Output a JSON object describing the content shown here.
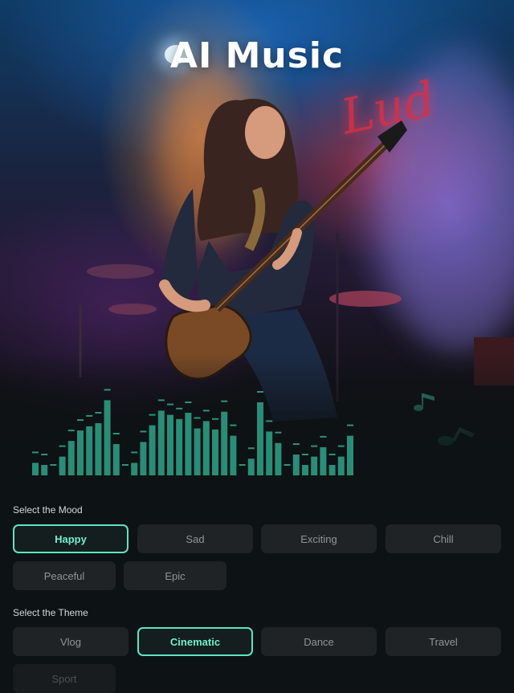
{
  "hero": {
    "title": "AI Music",
    "neon_sign_text": "Lud",
    "visualizer_levels": [
      0.12,
      0.1,
      0.0,
      0.18,
      0.33,
      0.43,
      0.47,
      0.5,
      0.72,
      0.3,
      0.0,
      0.12,
      0.32,
      0.48,
      0.62,
      0.58,
      0.54,
      0.6,
      0.45,
      0.52,
      0.44,
      0.61,
      0.38,
      0.0,
      0.16,
      0.7,
      0.42,
      0.31,
      0.0,
      0.2,
      0.1,
      0.18,
      0.27,
      0.1,
      0.18,
      0.38
    ]
  },
  "mood": {
    "label": "Select the Mood",
    "options": [
      {
        "label": "Happy",
        "selected": true
      },
      {
        "label": "Sad",
        "selected": false
      },
      {
        "label": "Exciting",
        "selected": false
      },
      {
        "label": "Chill",
        "selected": false
      },
      {
        "label": "Peaceful",
        "selected": false
      },
      {
        "label": "Epic",
        "selected": false
      }
    ]
  },
  "theme": {
    "label": "Select the Theme",
    "options": [
      {
        "label": "Vlog",
        "selected": false
      },
      {
        "label": "Cinematic",
        "selected": true
      },
      {
        "label": "Dance",
        "selected": false
      },
      {
        "label": "Travel",
        "selected": false
      },
      {
        "label": "Sport",
        "selected": false
      }
    ]
  },
  "colors": {
    "accent": "#5fe3c4",
    "visualizer": "#2fa38a",
    "chip_bg": "#1f2326",
    "background": "#0d1214"
  }
}
